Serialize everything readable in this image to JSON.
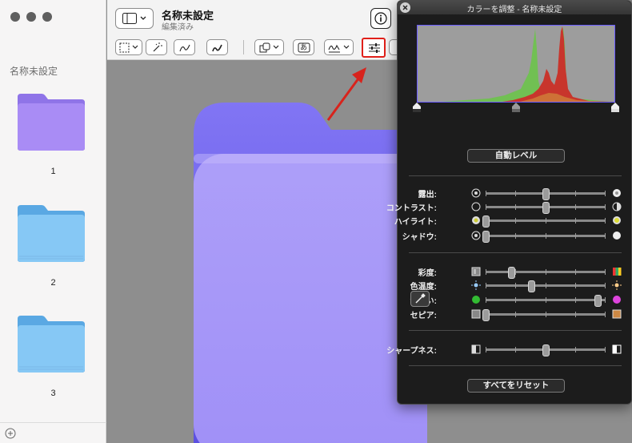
{
  "sidebar": {
    "title": "名称未設定",
    "items": [
      {
        "label": "1",
        "color": "#a98cf5",
        "tab": "#8f74e8"
      },
      {
        "label": "2",
        "color": "#86c8f5",
        "tab": "#5aa8e3"
      },
      {
        "label": "3",
        "color": "#86c8f5",
        "tab": "#5aa8e3"
      }
    ]
  },
  "toolbar": {
    "title": "名称未設定",
    "subtitle": "編集済み",
    "text_tool_glyph": "あ",
    "highlight_color": "#e0201a"
  },
  "canvas": {
    "folder_color": "#a594f9",
    "folder_tab_color": "#7d6df0"
  },
  "panel": {
    "title": "カラーを調整 - 名称未設定",
    "auto_levels": "自動レベル",
    "reset_all": "すべてをリセット",
    "sliders": [
      {
        "label": "露出:",
        "value": 0.5,
        "left_icon": "exposure-low-icon",
        "right_icon": "exposure-high-icon"
      },
      {
        "label": "コントラスト:",
        "value": 0.5,
        "left_icon": "contrast-low-icon",
        "right_icon": "contrast-high-icon"
      },
      {
        "label": "ハイライト:",
        "value": 0.0,
        "left_icon": "highlight-low-icon",
        "right_icon": "highlight-high-icon"
      },
      {
        "label": "シャドウ:",
        "value": 0.0,
        "left_icon": "shadow-low-icon",
        "right_icon": "shadow-high-icon"
      },
      {
        "label": "彩度:",
        "value": 0.21,
        "left_icon": "saturation-low-icon",
        "right_icon": "saturation-high-icon"
      },
      {
        "label": "色温度:",
        "value": 0.38,
        "left_icon": "temperature-cool-icon",
        "right_icon": "temperature-warm-icon"
      },
      {
        "label": "色合い:",
        "value": 0.93,
        "left_icon": "tint-green-icon",
        "right_icon": "tint-magenta-icon"
      },
      {
        "label": "セピア:",
        "value": 0.0,
        "left_icon": "sepia-low-icon",
        "right_icon": "sepia-high-icon"
      },
      {
        "label": "シャープネス:",
        "value": 0.5,
        "left_icon": "sharpness-low-icon",
        "right_icon": "sharpness-high-icon"
      }
    ],
    "histogram_levels": {
      "black": 0.0,
      "gamma": 0.5,
      "white": 1.0
    }
  }
}
